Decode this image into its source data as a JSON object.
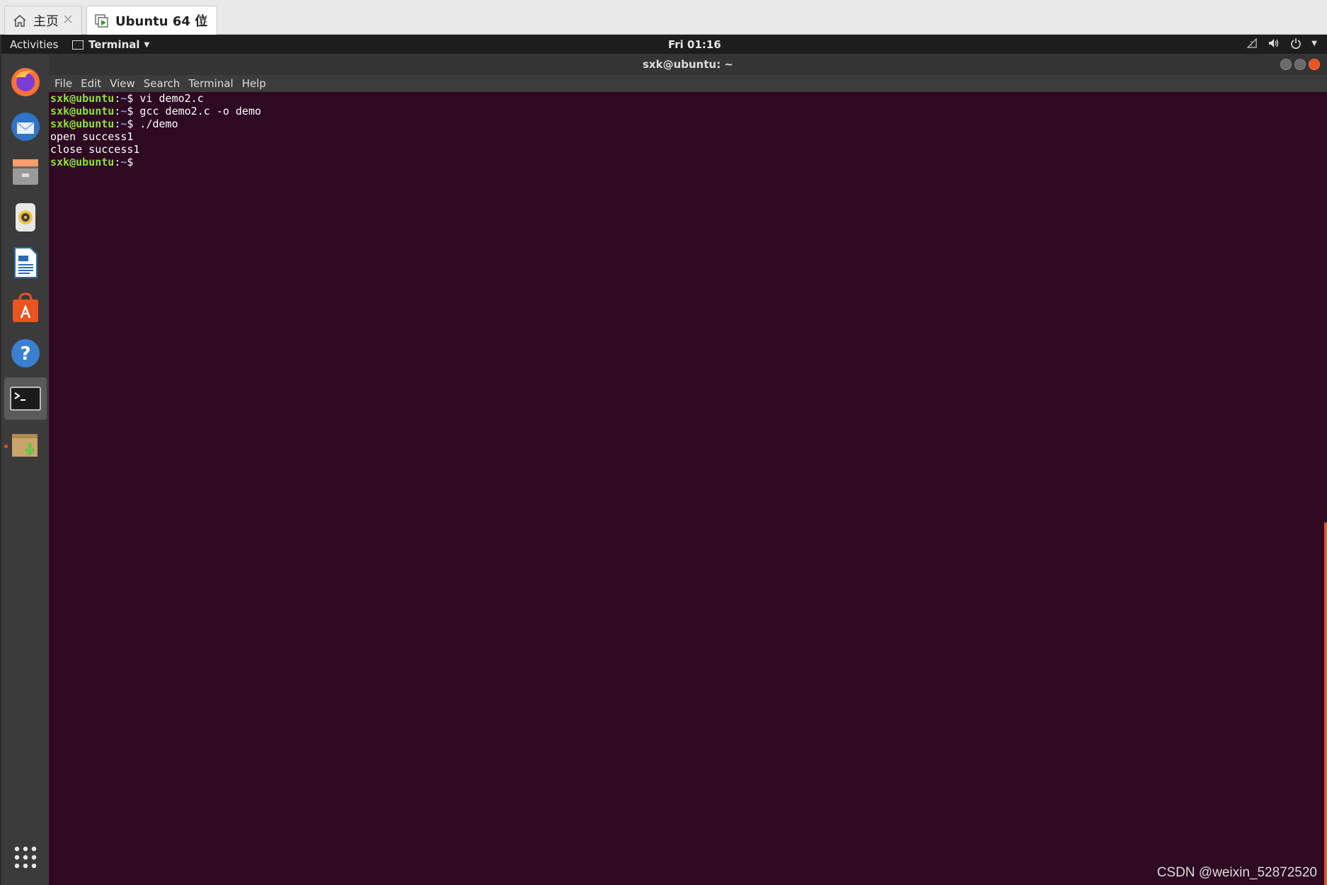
{
  "vm_tabs": [
    {
      "label": "主页",
      "icon": "home-icon"
    },
    {
      "label": "Ubuntu 64 位",
      "icon": "vm-play-icon"
    }
  ],
  "topbar": {
    "activities": "Activities",
    "app_menu": "Terminal",
    "clock": "Fri 01:16",
    "sys_icons": [
      "network-icon",
      "volume-icon",
      "power-icon",
      "caret-down-icon"
    ]
  },
  "dock": {
    "apps": [
      {
        "name": "firefox-icon"
      },
      {
        "name": "thunderbird-icon"
      },
      {
        "name": "files-icon"
      },
      {
        "name": "rhythmbox-icon"
      },
      {
        "name": "libreoffice-writer-icon"
      },
      {
        "name": "ubuntu-software-icon"
      },
      {
        "name": "help-icon"
      },
      {
        "name": "terminal-icon",
        "active": true
      },
      {
        "name": "package-installer-icon"
      },
      {
        "name": "show-applications-icon"
      }
    ]
  },
  "terminal": {
    "title": "sxk@ubuntu: ~",
    "menu": [
      "File",
      "Edit",
      "View",
      "Search",
      "Terminal",
      "Help"
    ],
    "lines": [
      {
        "user": "sxk@ubuntu",
        "path": "~",
        "cmd": " vi demo2.c"
      },
      {
        "user": "sxk@ubuntu",
        "path": "~",
        "cmd": " gcc demo2.c -o demo"
      },
      {
        "user": "sxk@ubuntu",
        "path": "~",
        "cmd": " ./demo"
      },
      {
        "output": "open success1"
      },
      {
        "output": "close success1"
      },
      {
        "user": "sxk@ubuntu",
        "path": "~",
        "cmd": ""
      }
    ]
  },
  "watermark": "CSDN @weixin_52872520",
  "colors": {
    "terminal_bg": "#2d0922",
    "prompt_user": "#8ae234",
    "prompt_path": "#729fcf",
    "accent": "#e95420"
  }
}
